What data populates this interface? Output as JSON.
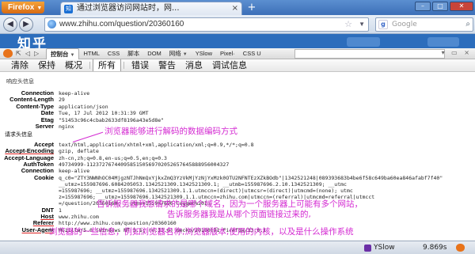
{
  "browser": {
    "menu_button": "Firefox",
    "tab_title": "通过浏览器访问网站时，网...",
    "tab_icon": "知",
    "url": "www.zhihu.com/question/20360160",
    "search_placeholder": "Google"
  },
  "page": {
    "logo": "知乎"
  },
  "firebug": {
    "tabs": [
      {
        "label": "控制台",
        "dropdown": true
      },
      {
        "label": "HTML"
      },
      {
        "label": "CSS"
      },
      {
        "label": "脚本"
      },
      {
        "label": "DOM"
      },
      {
        "label": "网络",
        "dropdown": true
      },
      {
        "label": "YSlow"
      },
      {
        "label": "Pixel·"
      },
      {
        "label": "CSS U"
      }
    ],
    "filters": [
      {
        "label": "清除"
      },
      {
        "label": "保持"
      },
      {
        "label": "概况"
      },
      {
        "label": "所有",
        "selected": true
      },
      {
        "label": "错误"
      },
      {
        "label": "警告"
      },
      {
        "label": "消息"
      },
      {
        "label": "调试信息"
      }
    ]
  },
  "response_section": {
    "title": "响应头信息",
    "headers": [
      {
        "name": "Connection",
        "value": "keep-alive"
      },
      {
        "name": "Content-Length",
        "value": "29"
      },
      {
        "name": "Content-Type",
        "value": "application/json"
      },
      {
        "name": "Date",
        "value": "Tue, 17 Jul 2012 10:31:39 GMT"
      },
      {
        "name": "Etag",
        "value": "\"51453c96c4cbab2633df8196a43e5d8e\""
      },
      {
        "name": "Server",
        "value": "nginx"
      }
    ]
  },
  "request_section": {
    "title": "请求头信息",
    "headers": [
      {
        "name": "Accept",
        "value": "text/html,application/xhtml+xml,application/xml;q=0.9,*/*;q=0.8"
      },
      {
        "name": "Accept-Encoding",
        "value": "gzip, deflate"
      },
      {
        "name": "Accept-Language",
        "value": "zh-cn,zh;q=0.8,en-us;q=0.5,en;q=0.3"
      },
      {
        "name": "AuthToken",
        "value": "49734999-1123727674409585150569702052657645888956004327"
      },
      {
        "name": "Connection",
        "value": "keep-alive"
      },
      {
        "name": "Cookie",
        "value": "q_c0=\"ZTY3NWNhOC04MjgzNTJhNmQxYjkxZmQ3YzVkMjYzNjYxMzk0OTU2NFNTEzXZkBOdb\"|1342521248|089393683b4be6f58c649ba60ea846afabf7f40\""
      },
      {
        "name": "DNT",
        "value": "1"
      },
      {
        "name": "Host",
        "value": "www.zhihu.com"
      },
      {
        "name": "Referer",
        "value": "http://www.zhihu.com/question/20360160"
      },
      {
        "name": "User-Agent",
        "value": "Mozilla/5.0 (Windows NT 5.1; rv:13.0) Gecko/20100101 Firefox/13.0.1"
      }
    ],
    "cookie_lines": [
      "q_c0=\"ZTY3NWNhOC04MjgzNTJhNmQxYjkxZmQ3YzVkMjYzNjYxMzk0OTU2NFNTEzXZkBOdb\"|1342521248|089393683b4be6f58c649ba60ea846afabf7f40\"",
      "__utmz=155987696.6084205053.1342521309.1342521309.1;  __utmb=155987696.2.10.1342521309;  __utmc",
      "=155987696;  __utmz=155987696.1342521309.1.1.utmccn=(direct)|utmcsr=(direct)|utmcmd=(none); utmc",
      "z=155987696;  __utmz=155987696.1342521309.1.1.utmccn=zhihu.com|utmccn=(referral)|utmcmd=referral|utmcct",
      "=/question/20360160;  __utmv=155987696.Logged%20In"
    ]
  },
  "annotations": {
    "accept_encoding": "浏览器能够进行解码的数据编码方式",
    "host": "告诉服务器我想请求的是哪个域名，因为一个服务器上可能有多个网站，",
    "referer": "告诉服务器我是从哪个页面链接过来的,",
    "user_agent": "浏览器的一些信息，例如浏览器名称,浏览器版本,使用的内核，以及是什么操作系统"
  },
  "statusbar": {
    "yslow": "YSlow",
    "time": "9.869s"
  },
  "colors": {
    "annotation": "#d42cd2",
    "titlebar": "#3c6fb8",
    "page_header": "#2c6dbc"
  }
}
